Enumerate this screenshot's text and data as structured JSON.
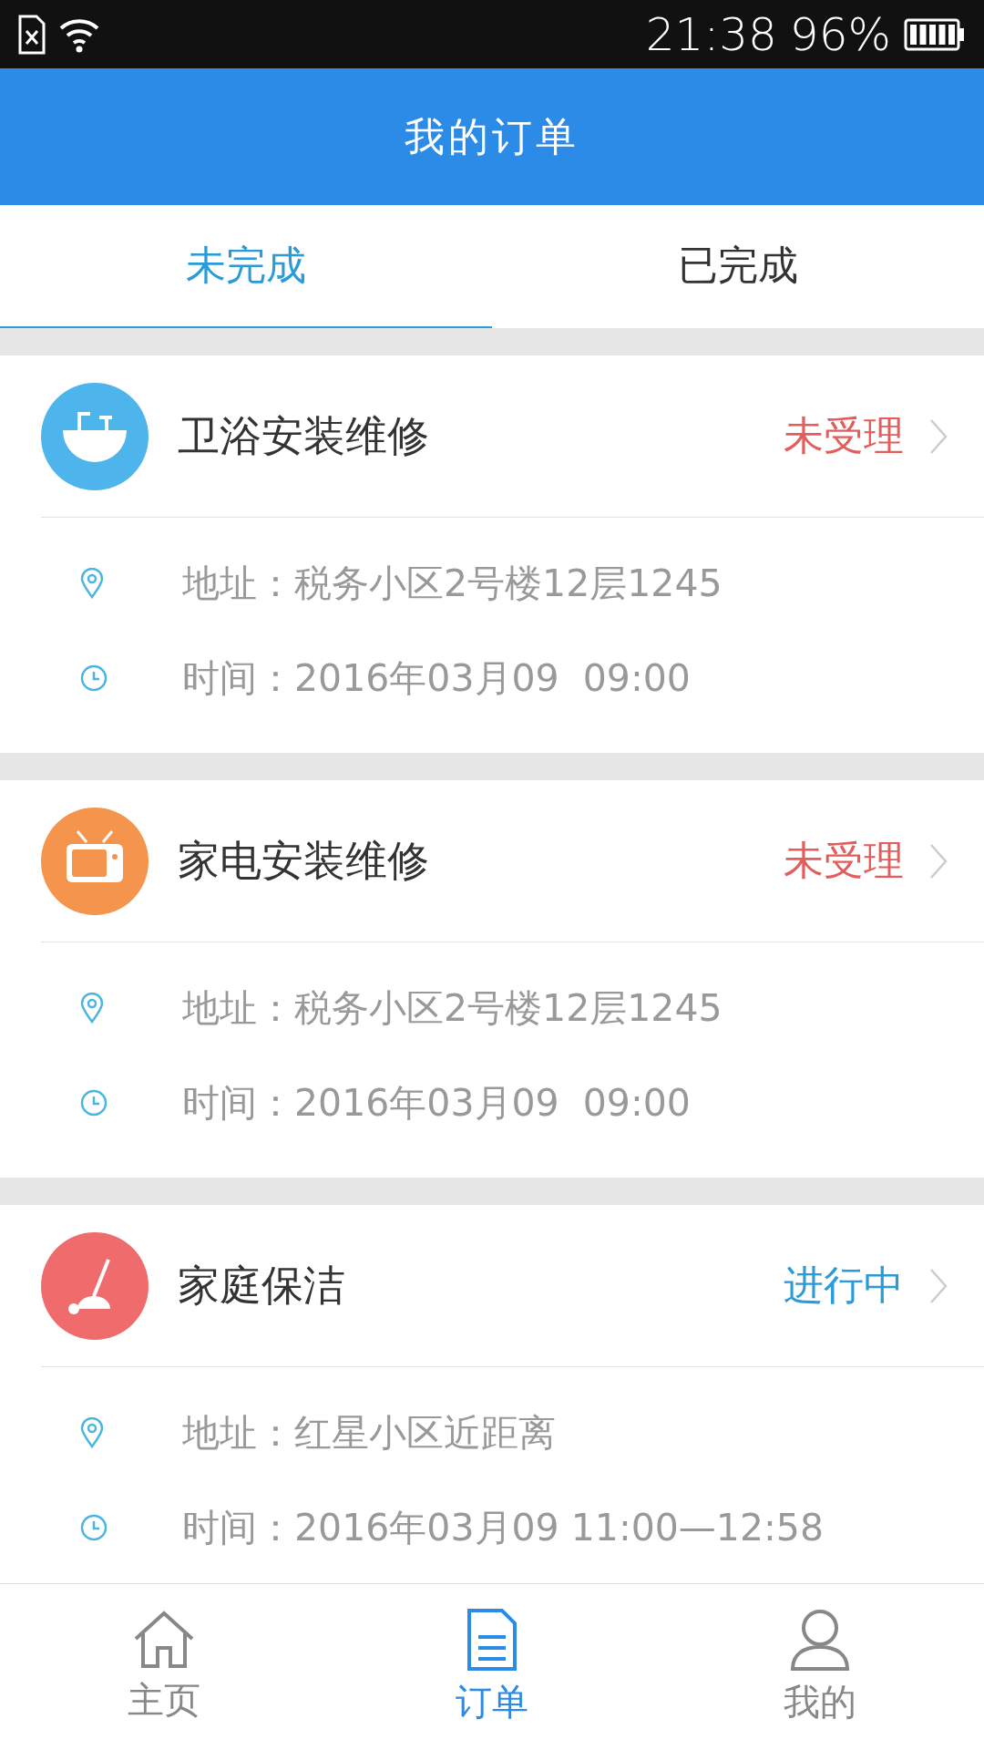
{
  "status_bar": {
    "time": "21:38",
    "battery": "96%"
  },
  "header": {
    "title": "我的订单"
  },
  "tabs": [
    {
      "label": "未完成",
      "selected": true
    },
    {
      "label": "已完成",
      "selected": false
    }
  ],
  "orders": [
    {
      "kind": "bathroom",
      "title": "卫浴安装维修",
      "status": "未受理",
      "color": "#e35d5d",
      "address": "地址：税务小区2号楼12层1245",
      "time": "时间：2016年03月09  09:00"
    },
    {
      "kind": "appliance",
      "title": "家电安装维修",
      "status": "未受理",
      "color": "#e35d5d",
      "address": "地址：税务小区2号楼12层1245",
      "time": "时间：2016年03月09  09:00"
    },
    {
      "kind": "cleaning",
      "title": "家庭保洁",
      "status": "进行中",
      "color": "#2a9ad8",
      "address": "地址：红星小区近距离",
      "time": "时间：2016年03月09 11:00—12:58"
    }
  ],
  "nav": [
    {
      "label": "主页",
      "selected": false
    },
    {
      "label": "订单",
      "selected": true
    },
    {
      "label": "我的",
      "selected": false
    }
  ]
}
